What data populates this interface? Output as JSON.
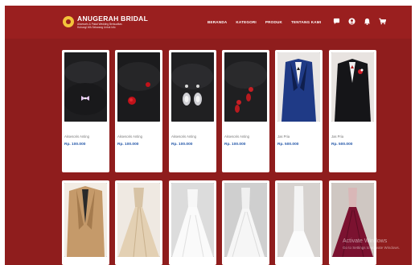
{
  "brand": {
    "title": "ANUGERAH BRIDAL",
    "subtitle_line1": "Aksesoris & Pakai Wedding Berkualitas",
    "subtitle_line2": "Hubungi WA Sekarang Untuk Info"
  },
  "nav": {
    "items": [
      {
        "label": "BERANDA"
      },
      {
        "label": "KATEGORI"
      },
      {
        "label": "PRODUK"
      },
      {
        "label": "TENTANG KAMI"
      }
    ],
    "icons": [
      "chat-icon",
      "user-icon",
      "bell-icon",
      "cart-icon"
    ]
  },
  "products_row1": [
    {
      "name": "Aksesoris Anting",
      "price": "Rp. 100.000",
      "image": "earring-bow"
    },
    {
      "name": "Aksesoris Anting",
      "price": "Rp. 100.000",
      "image": "earring-red-rose"
    },
    {
      "name": "Aksesoris Anting",
      "price": "Rp. 100.000",
      "image": "earring-crystal-drop"
    },
    {
      "name": "Aksesoris Anting",
      "price": "Rp. 100.000",
      "image": "earring-red-dangle"
    },
    {
      "name": "Jas Pria",
      "price": "Rp. 500.000",
      "image": "blue-suit"
    },
    {
      "name": "Jas Pria",
      "price": "Rp. 500.000",
      "image": "black-suit-red-flower"
    }
  ],
  "products_row2": [
    {
      "image": "tan-suit"
    },
    {
      "image": "champagne-gown"
    },
    {
      "image": "white-ballgown"
    },
    {
      "image": "white-tulle-gown"
    },
    {
      "image": "white-mermaid-gown"
    },
    {
      "image": "maroon-gown"
    }
  ],
  "watermark": {
    "title": "Activate Windows",
    "subtitle": "Go to Settings to activate Windows."
  },
  "colors": {
    "background": "#8f1d1d",
    "navbar": "#9a1f1f",
    "card": "#ffffff",
    "price": "#2457a8",
    "logo": "#f3c33b"
  }
}
